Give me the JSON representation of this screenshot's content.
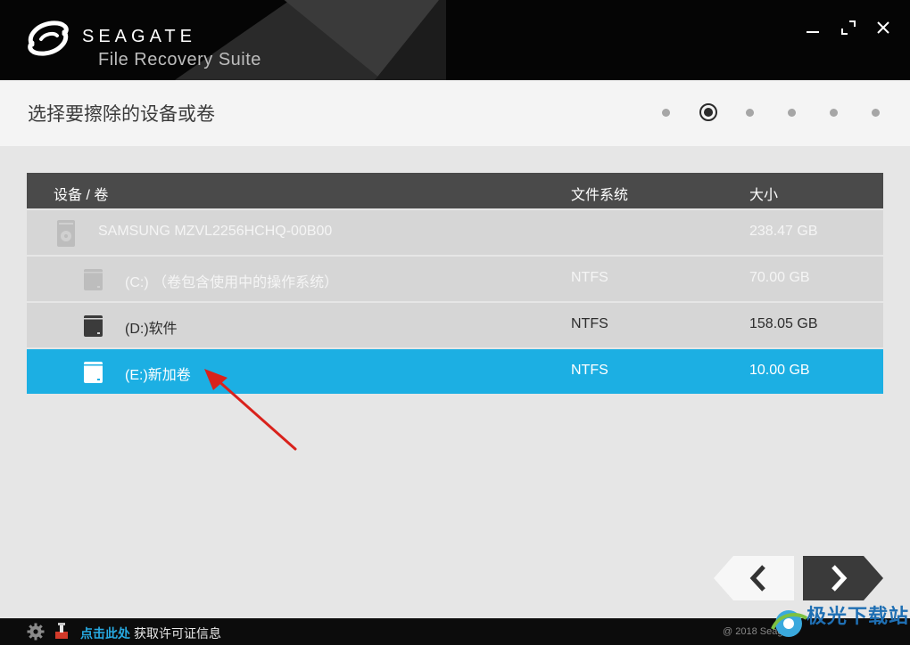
{
  "window": {
    "brand": "SEAGATE",
    "product": "File Recovery Suite"
  },
  "step": {
    "title": "选择要擦除的设备或卷",
    "total_steps": 6,
    "current_step_index": 1
  },
  "table": {
    "headers": {
      "name": "设备 / 卷",
      "fs": "文件系统",
      "size": "大小"
    },
    "rows": [
      {
        "name": "SAMSUNG MZVL2256HCHQ-00B00",
        "fs": "",
        "size": "238.47 GB",
        "kind": "device",
        "state": "disabled"
      },
      {
        "name": "(C:) （卷包含使用中的操作系统）",
        "fs": "NTFS",
        "size": "70.00 GB",
        "kind": "volume",
        "state": "disabled"
      },
      {
        "name": "(D:)软件",
        "fs": "NTFS",
        "size": "158.05 GB",
        "kind": "volume",
        "state": "normal"
      },
      {
        "name": "(E:)新加卷",
        "fs": "NTFS",
        "size": "10.00 GB",
        "kind": "volume",
        "state": "selected"
      }
    ]
  },
  "footer": {
    "license_link": "点击此处",
    "license_text": "获取许可证信息",
    "copyright": "@ 2018 Seagate",
    "watermark": "极光下载站"
  },
  "colors": {
    "accent": "#1cafe3",
    "header_bg": "#050505",
    "table_head": "#4a4a4a",
    "arrow": "#d9221c"
  },
  "icons": [
    "seagate-logo-icon",
    "minimize-icon",
    "maximize-icon",
    "close-icon",
    "drive-icon",
    "volume-icon",
    "chevron-left-icon",
    "chevron-right-icon",
    "gear-icon",
    "license-icon"
  ]
}
